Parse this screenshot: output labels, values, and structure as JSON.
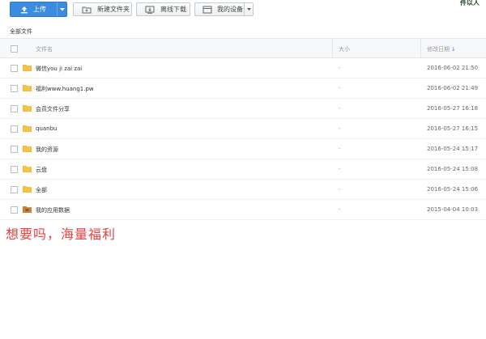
{
  "toolbar": {
    "upload_label": "上传",
    "new_folder_label": "新建文件夹",
    "offline_download_label": "离线下载",
    "my_devices_label": "我的设备"
  },
  "corner_text": "件以人",
  "breadcrumb": "全部文件",
  "table": {
    "columns": {
      "name": "文件名",
      "size": "大小",
      "modified": "修改日期"
    },
    "rows": [
      {
        "name": "微信you ji zai zai",
        "size": "-",
        "modified": "2016-06-02 21:50",
        "icon": "folder-icon"
      },
      {
        "name": "福利www.huang1.pw",
        "size": "-",
        "modified": "2016-06-02 21:49",
        "icon": "folder-icon"
      },
      {
        "name": "会员文件分享",
        "size": "-",
        "modified": "2016-05-27 16:18",
        "icon": "folder-icon"
      },
      {
        "name": "quanbu",
        "size": "-",
        "modified": "2016-05-27 16:15",
        "icon": "folder-icon"
      },
      {
        "name": "我的资源",
        "size": "-",
        "modified": "2016-05-24 15:17",
        "icon": "folder-icon"
      },
      {
        "name": "云盘",
        "size": "-",
        "modified": "2016-05-24 15:08",
        "icon": "folder-icon"
      },
      {
        "name": "全部",
        "size": "-",
        "modified": "2016-05-24 15:06",
        "icon": "folder-icon"
      },
      {
        "name": "我的应用数据",
        "size": "-",
        "modified": "2015-04-04 10:03",
        "icon": "app-folder-icon"
      }
    ]
  },
  "promo_text": "想要吗，海量福利",
  "colors": {
    "accent": "#3b8cde",
    "folder": "#f5c542",
    "promo": "#e8403f"
  }
}
